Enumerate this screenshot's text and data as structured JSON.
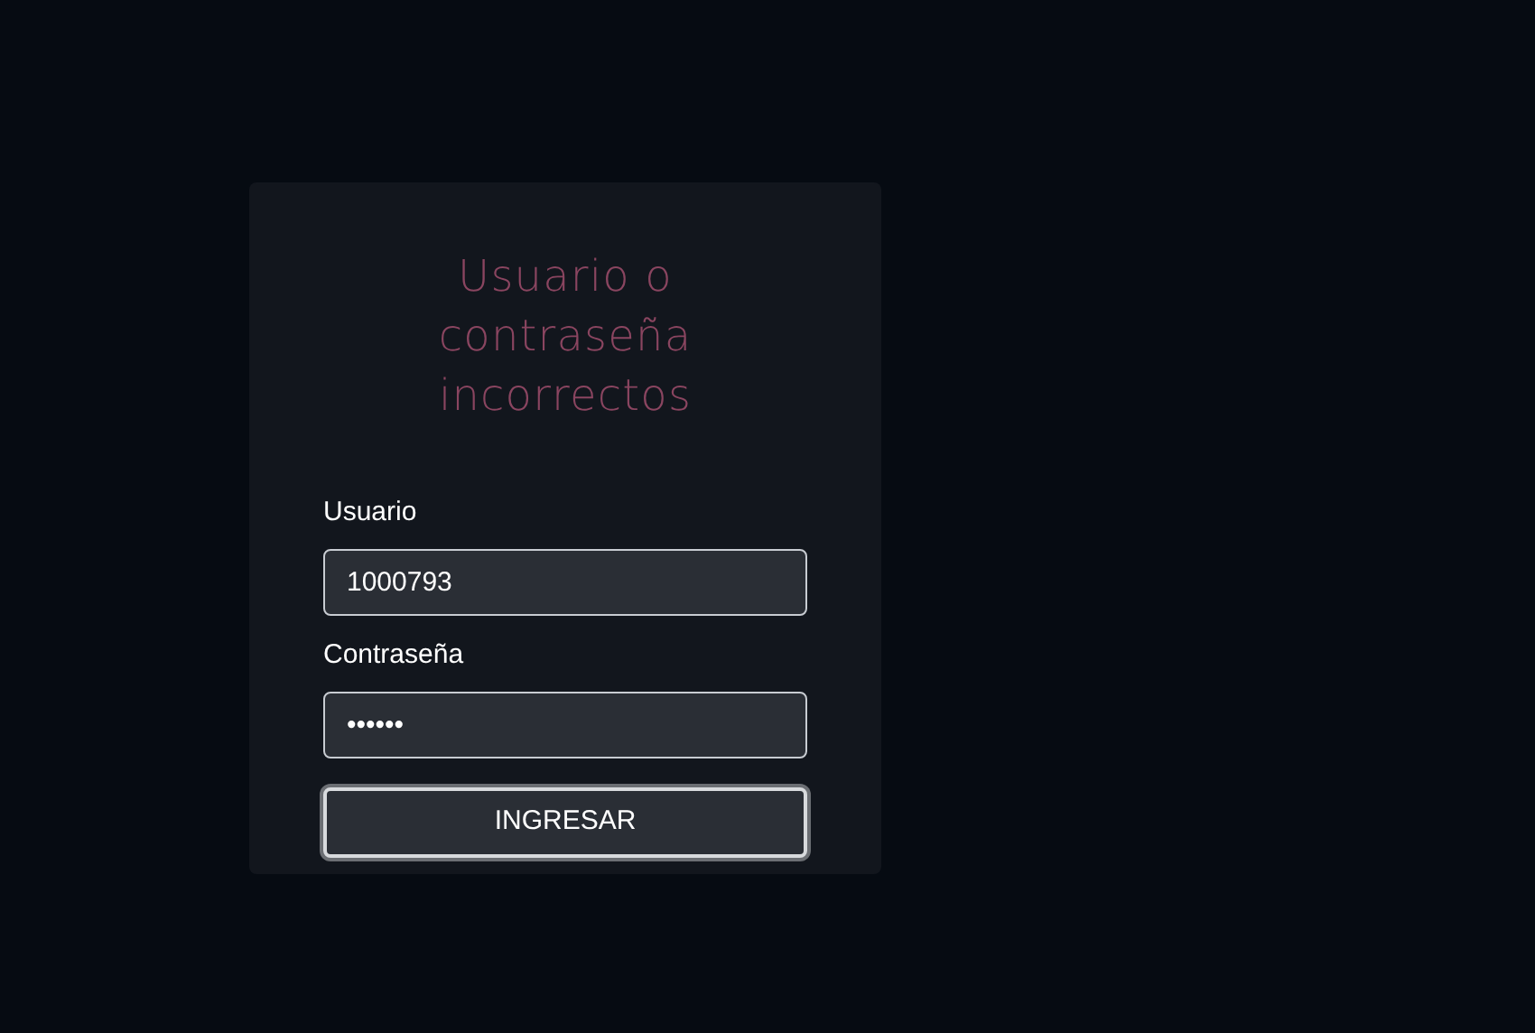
{
  "login_card": {
    "error_message": "Usuario o contraseña incorrectos",
    "fields": [
      {
        "label": "Usuario",
        "value": "1000793"
      },
      {
        "label": "Contraseña",
        "value": "••••••"
      }
    ],
    "submit_button": {
      "label": "INGRESAR",
      "focused": true
    }
  }
}
